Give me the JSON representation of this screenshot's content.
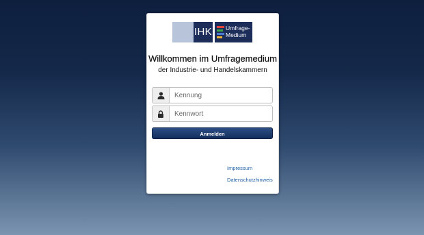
{
  "logos": {
    "ihk_text": "IHK",
    "umfrage_line1": "Umfrage-",
    "umfrage_line2": "Medium",
    "umfrage_bar_colors": [
      "#e0443a",
      "#3aa84a",
      "#4a78d0",
      "#f2b233"
    ]
  },
  "title": "Willkommen im Umfragemedium",
  "subtitle": "der Industrie- und Handelskammern",
  "form": {
    "username": {
      "placeholder": "Kennung",
      "value": "",
      "icon": "user-icon"
    },
    "password": {
      "placeholder": "Kennwort",
      "value": "",
      "icon": "lock-icon"
    },
    "submit_label": "Anmelden"
  },
  "links": {
    "impressum": "Impressum",
    "datenschutz": "Datenschutzhinweis"
  },
  "colors": {
    "brand_navy": "#1d2d5a",
    "button": "#1b3568",
    "link": "#1f5fa8"
  }
}
